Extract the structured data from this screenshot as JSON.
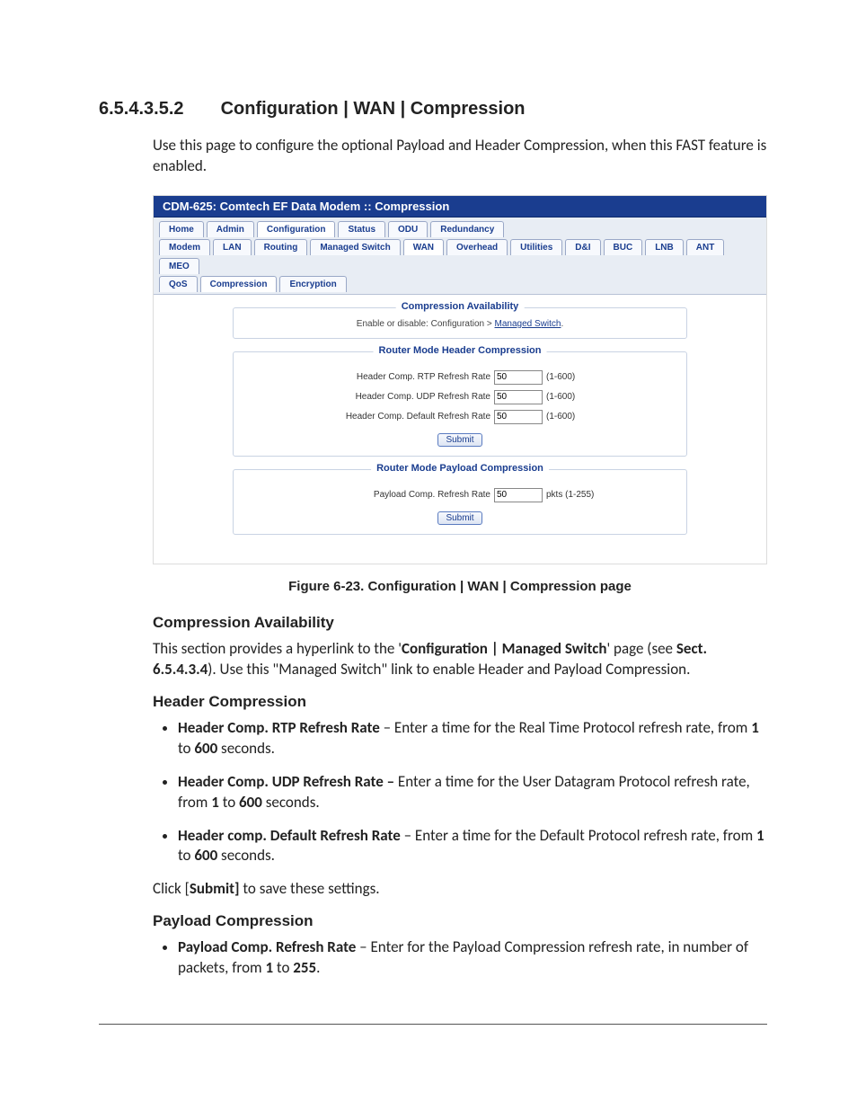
{
  "section": {
    "number": "6.5.4.3.5.2",
    "title": "Configuration | WAN | Compression",
    "intro": "Use this page to configure the optional Payload and Header Compression, when this FAST feature is enabled."
  },
  "screenshot": {
    "window_title": "CDM-625: Comtech EF Data Modem :: Compression",
    "tabs_row1": [
      "Home",
      "Admin",
      "Configuration",
      "Status",
      "ODU",
      "Redundancy"
    ],
    "tabs_row1_active": "Configuration",
    "tabs_row2": [
      "Modem",
      "LAN",
      "Routing",
      "Managed Switch",
      "WAN",
      "Overhead",
      "Utilities",
      "D&I",
      "BUC",
      "LNB",
      "ANT",
      "MEO"
    ],
    "tabs_row2_active": "WAN",
    "tabs_row3": [
      "QoS",
      "Compression",
      "Encryption"
    ],
    "tabs_row3_active": "Compression",
    "fieldset_availability": {
      "legend": "Compression Availability",
      "text_prefix": "Enable or disable: Configuration > ",
      "link_text": "Managed Switch",
      "text_suffix": "."
    },
    "fieldset_header": {
      "legend": "Router Mode Header Compression",
      "rows": [
        {
          "label": "Header Comp. RTP Refresh Rate",
          "value": "50",
          "range": "(1-600)"
        },
        {
          "label": "Header Comp. UDP Refresh Rate",
          "value": "50",
          "range": "(1-600)"
        },
        {
          "label": "Header Comp. Default Refresh Rate",
          "value": "50",
          "range": "(1-600)"
        }
      ],
      "submit": "Submit"
    },
    "fieldset_payload": {
      "legend": "Router Mode Payload Compression",
      "rows": [
        {
          "label": "Payload Comp. Refresh Rate",
          "value": "50",
          "range": "pkts (1-255)"
        }
      ],
      "submit": "Submit"
    }
  },
  "figure_caption": "Figure 6-23. Configuration | WAN | Compression page",
  "sect_avail": {
    "heading": "Compression Availability",
    "text_parts": {
      "p1a": "This section provides a hyperlink to the '",
      "p1b": "Configuration | Managed Switch",
      "p1c": "' page (see ",
      "p1d": "Sect. 6.5.4.3.4",
      "p1e": "). Use this \"Managed Switch\" link to enable Header and Payload Compression."
    }
  },
  "sect_header": {
    "heading": "Header Compression",
    "bullets": [
      {
        "b": "Header Comp. RTP Refresh Rate",
        "t": " – Enter a time for the Real Time Protocol refresh rate, from ",
        "n1": "1",
        "mid": " to ",
        "n2": "600",
        "tail": " seconds."
      },
      {
        "b": "Header Comp. UDP Refresh Rate –",
        "t": " Enter a time for the User Datagram Protocol refresh rate, from ",
        "n1": "1",
        "mid": " to ",
        "n2": "600",
        "tail": " seconds."
      },
      {
        "b": "Header comp. Default Refresh Rate",
        "t": " – Enter a time for the Default Protocol refresh rate, from ",
        "n1": "1",
        "mid": " to ",
        "n2": "600",
        "tail": " seconds."
      }
    ],
    "note_parts": {
      "a": "Click [",
      "b": "Submit]",
      "c": " to save these settings."
    }
  },
  "sect_payload": {
    "heading": "Payload Compression",
    "bullets": [
      {
        "b": "Payload Comp. Refresh Rate",
        "t": " – Enter for the Payload Compression refresh rate, in number of packets, from ",
        "n1": "1",
        "mid": " to ",
        "n2": "255",
        "tail": "."
      }
    ]
  }
}
